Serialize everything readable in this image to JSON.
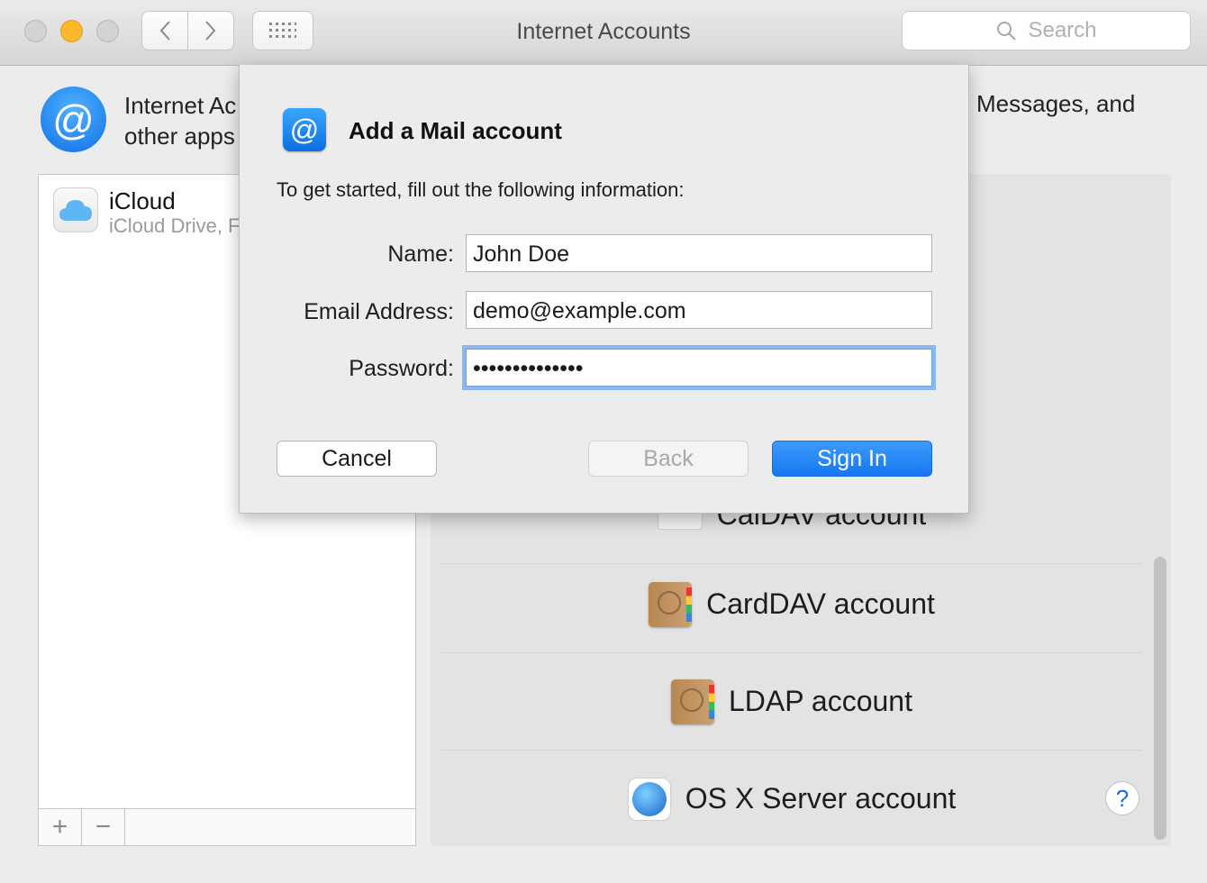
{
  "window": {
    "title": "Internet Accounts"
  },
  "toolbar": {
    "search_placeholder": "Search"
  },
  "header": {
    "line1": "Internet Ac",
    "line2": "other apps",
    "tail": "Messages, and"
  },
  "accounts": [
    {
      "name": "iCloud",
      "detail": "iCloud Drive, F"
    }
  ],
  "list_footer": {
    "add": "+",
    "remove": "−"
  },
  "providers": [
    {
      "label": "CalDAV account",
      "icon": "calendar-icon"
    },
    {
      "label": "CardDAV account",
      "icon": "contacts-icon"
    },
    {
      "label": "LDAP account",
      "icon": "contacts-icon"
    },
    {
      "label": "OS X Server account",
      "icon": "globe-icon"
    }
  ],
  "help": {
    "label": "?"
  },
  "sheet": {
    "title": "Add a Mail account",
    "intro": "To get started, fill out the following information:",
    "fields": {
      "name_label": "Name:",
      "name_value": "John Doe",
      "email_label": "Email Address:",
      "email_value": "demo@example.com",
      "password_label": "Password:",
      "password_value": "••••••••••••••"
    },
    "buttons": {
      "cancel": "Cancel",
      "back": "Back",
      "sign_in": "Sign In"
    }
  },
  "colors": {
    "accent": "#1677f2",
    "focus_ring": "#8ab8ec"
  }
}
